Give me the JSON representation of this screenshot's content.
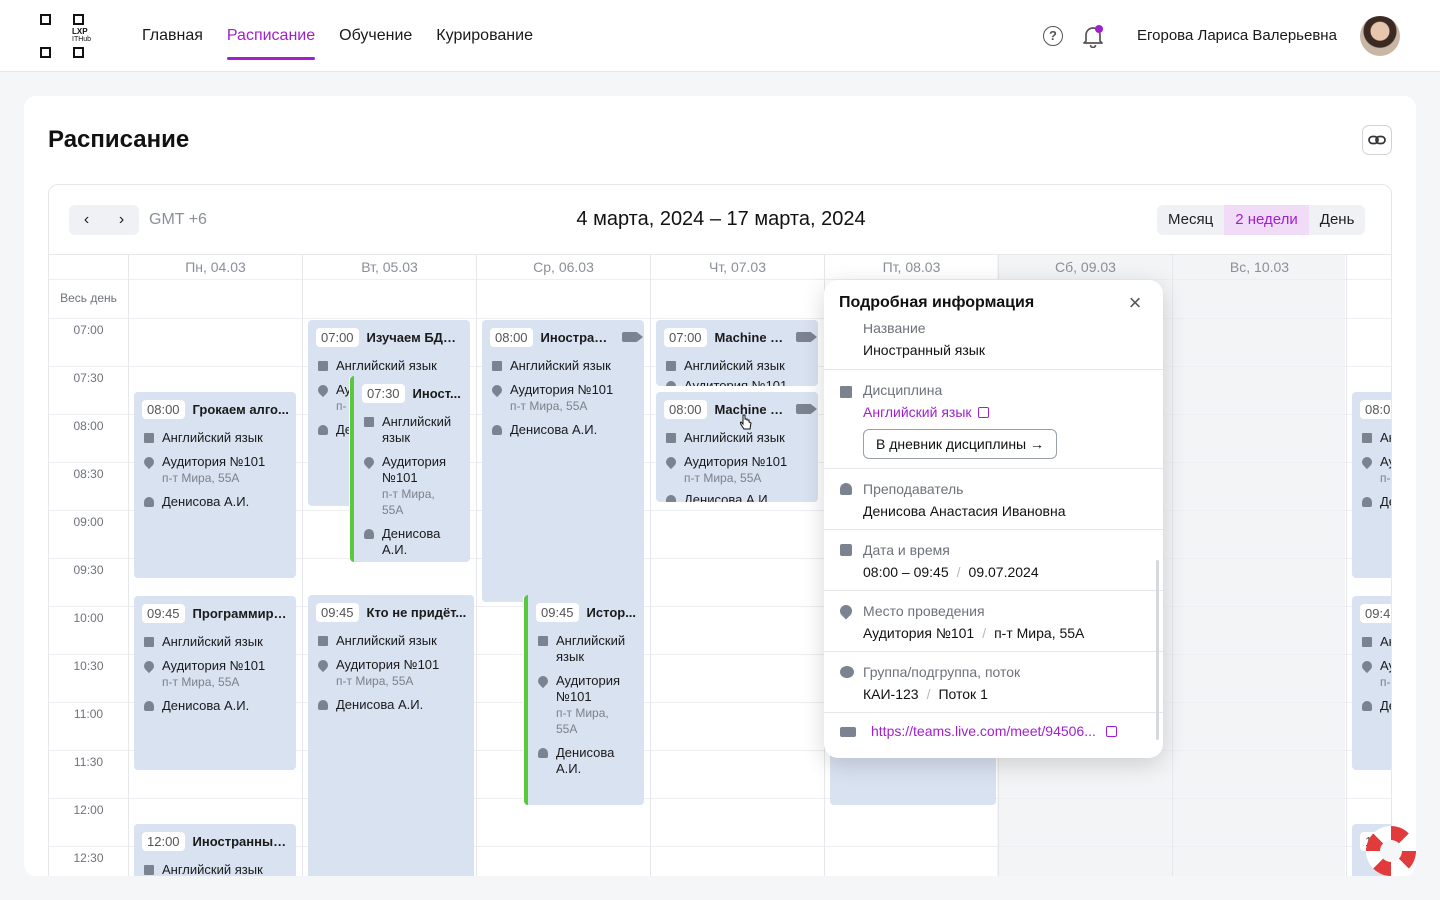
{
  "header": {
    "logo_text": "LXP",
    "logo_subtext": "ITHub",
    "nav": [
      {
        "label": "Главная"
      },
      {
        "label": "Расписание"
      },
      {
        "label": "Обучение"
      },
      {
        "label": "Курирование"
      }
    ],
    "help_glyph": "?",
    "user_name": "Егорова Лариса Валерьевна"
  },
  "page": {
    "title": "Расписание"
  },
  "calendar": {
    "prev_glyph": "‹",
    "next_glyph": "›",
    "timezone": "GMT +6",
    "range": "4 марта, 2024 – 17 марта, 2024",
    "views": [
      "Месяц",
      "2 недели",
      "День"
    ],
    "active_view": "2 недели",
    "days": [
      "Пн, 04.03",
      "Вт, 05.03",
      "Ср, 06.03",
      "Чт, 07.03",
      "Пт, 08.03",
      "Сб, 09.03",
      "Вс, 10.03"
    ],
    "allday_label": "Весь день",
    "times": [
      "07:00",
      "07:30",
      "08:00",
      "08:30",
      "09:00",
      "09:30",
      "10:00",
      "10:30",
      "11:00",
      "11:30",
      "12:00",
      "12:30"
    ],
    "events": {
      "e1": {
        "time": "08:00",
        "title": "Грокаем алго...",
        "discipline": "Английский язык",
        "room": "Аудитория №101",
        "address": "п-т Мира, 55А",
        "teacher": "Денисова А.И."
      },
      "e2": {
        "time": "09:45",
        "title": "Программиро...",
        "discipline": "Английский язык",
        "room": "Аудитория №101",
        "address": "п-т Мира, 55А",
        "teacher": "Денисова А.И."
      },
      "e3": {
        "time": "12:00",
        "title": "Иностранный...",
        "discipline": "Английский язык"
      },
      "e4": {
        "time": "07:00",
        "title": "Изучаем БДш...",
        "discipline": "Английский язык",
        "room_short": "Ау",
        "addr_short": "п-",
        "teacher_short": "Де"
      },
      "e5": {
        "time": "07:30",
        "title": "Иност...",
        "discipline_l1": "Английский",
        "discipline_l2": "язык",
        "room_l1": "Аудитория",
        "room_l2": "№101",
        "addr_l1": "п-т Мира,",
        "addr_l2": "55А",
        "teacher_l1": "Денисова",
        "teacher_l2": "А.И."
      },
      "e6": {
        "time": "09:45",
        "title": "Кто не придёт...",
        "discipline": "Английский язык",
        "room": "Аудитория №101",
        "address": "п-т Мира, 55А",
        "teacher": "Денисова А.И."
      },
      "e7": {
        "time": "08:00",
        "title": "Иностранн...",
        "discipline": "Английский язык",
        "room": "Аудитория №101",
        "address": "п-т Мира, 55А",
        "teacher": "Денисова А.И."
      },
      "e8": {
        "time": "09:45",
        "title": "Истор...",
        "discipline_l1": "Английский",
        "discipline_l2": "язык",
        "room_l1": "Аудитория",
        "room_l2": "№101",
        "addr_l1": "п-т Мира,",
        "addr_l2": "55А",
        "teacher_l1": "Денисова",
        "teacher_l2": "А.И."
      },
      "e9": {
        "time": "07:00",
        "title": "Machine L...",
        "discipline": "Английский язык",
        "room_cut": "Аудитория №101"
      },
      "e10": {
        "time": "08:00",
        "title": "Machine L...",
        "discipline": "Английский язык",
        "room": "Аудитория №101",
        "address": "п-т Мира, 55А",
        "teacher_cut": "Денисова А.И."
      },
      "e11": {
        "time": "08:0",
        "discipline": "Ан",
        "room": "Ау",
        "address": "п-",
        "teacher": "Де"
      },
      "e12": {
        "time": "09:4",
        "discipline": "Ан",
        "room": "Ау",
        "address": "п-",
        "teacher": "Де"
      },
      "e13": {
        "time": "12:"
      }
    }
  },
  "details": {
    "title": "Подробная информация",
    "close_glyph": "×",
    "name_label": "Название",
    "name_value": "Иностранный язык",
    "discipline_label": "Дисциплина",
    "discipline_value": "Английский язык",
    "diary_button": "В дневник дисциплины →",
    "teacher_label": "Преподаватель",
    "teacher_value": "Денисова Анастасия Ивановна",
    "datetime_label": "Дата и время",
    "time_value": "08:00 – 09:45",
    "date_value": "09.07.2024",
    "sep": "/",
    "place_label": "Место проведения",
    "room_value": "Аудитория №101",
    "address_value": "п-т Мира, 55А",
    "group_label": "Группа/подгруппа, поток",
    "group_value": "КАИ-123",
    "stream_value": "Поток 1",
    "link": "https://teams.live.com/meet/94506..."
  },
  "colors": {
    "accent": "#a21fcf",
    "event_bg": "#d9e2f1",
    "event_mark": "#5ac83c"
  }
}
